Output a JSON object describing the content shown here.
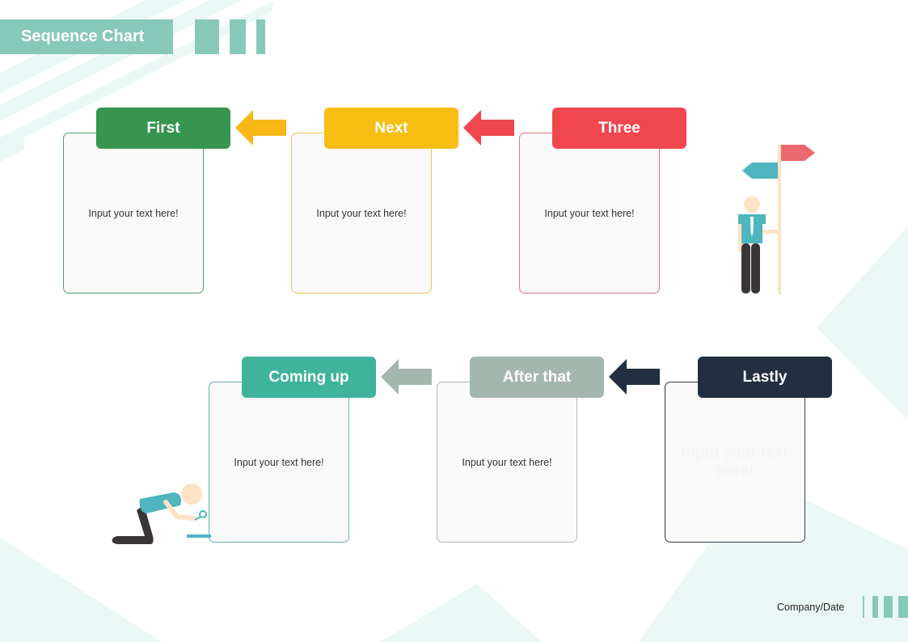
{
  "title": "Sequence Chart",
  "footer": "Company/Date",
  "colors": {
    "title_bg": "#88c8b9",
    "background_shape": "#eaf7f5"
  },
  "steps": [
    {
      "label": "First",
      "text": "Input your text here!",
      "color": "#36954f",
      "border": "#5a9a6a"
    },
    {
      "label": "Next",
      "text": "Input your text here!",
      "color": "#f7bd12",
      "border": "#efc64e"
    },
    {
      "label": "Three",
      "text": "Input your text here!",
      "color": "#f0474e",
      "border": "#e0737a"
    },
    {
      "label": "Lastly",
      "text": "Input your text here!",
      "color": "#222f40",
      "border": "#333b45"
    },
    {
      "label": "After that",
      "text": "Input your text here!",
      "color": "#a4b7ae",
      "border": "#b4b4b4"
    },
    {
      "label": "Coming up",
      "text": "Input your text here!",
      "color": "#3fb39b",
      "border": "#62b5ad"
    }
  ],
  "arrows": [
    {
      "from": "Next",
      "to": "First",
      "color": "#f6b717"
    },
    {
      "from": "Three",
      "to": "Next",
      "color": "#f0474e"
    },
    {
      "from": "Lastly",
      "to": "After that",
      "color": "#222f40"
    },
    {
      "from": "After that",
      "to": "Coming up",
      "color": "#a4b7ae"
    }
  ],
  "illustrations": [
    "person-with-signpost",
    "person-with-magnifier"
  ]
}
